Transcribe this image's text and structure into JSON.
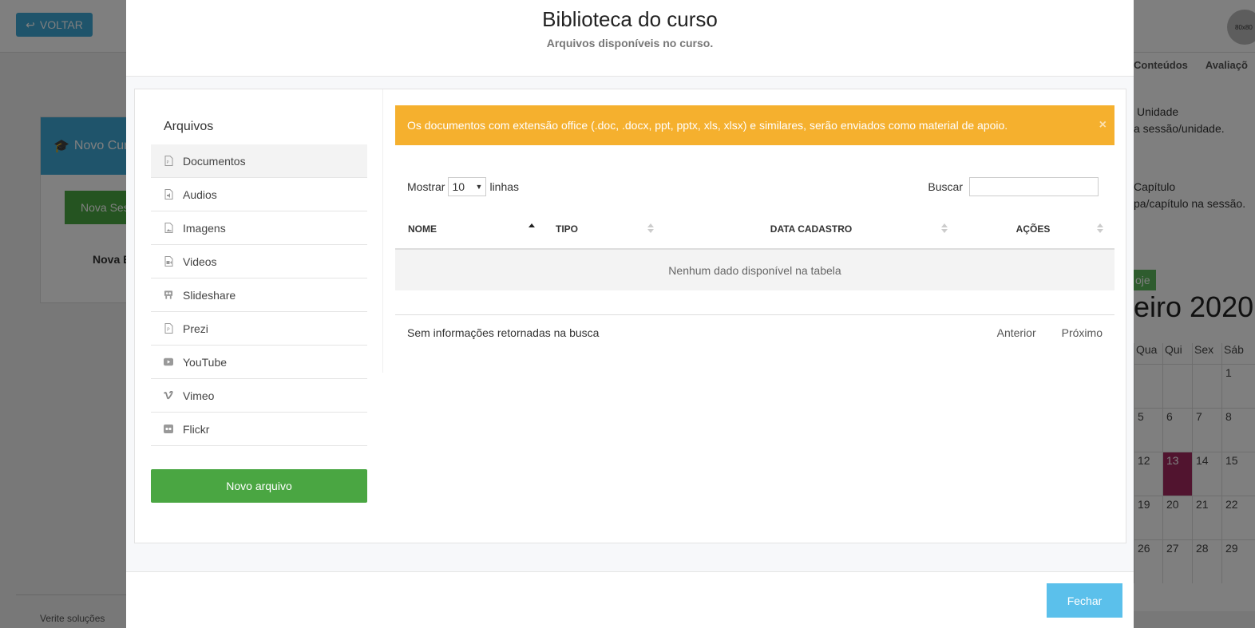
{
  "background": {
    "back_button": "VOLTAR",
    "avatar_text": "80x80",
    "card_title": "Novo Cur",
    "card_button": "Nova Ses",
    "card_text": "Nova E",
    "footer_text": "Verite soluções",
    "tabs": [
      "Conteúdos",
      "Avaliaçõ"
    ],
    "right_items": [
      {
        "title": "Unidade",
        "desc": "a sessão/unidade."
      },
      {
        "title": "Capítulo",
        "desc": "pa/capítulo na sessão."
      }
    ],
    "today_button": "oje",
    "month": "eiro 2020",
    "calendar_headers": [
      "Qua",
      "Qui",
      "Sex",
      "Sáb"
    ],
    "calendar_rows": [
      [
        "",
        "",
        "",
        "1"
      ],
      [
        "5",
        "6",
        "7",
        "8"
      ],
      [
        "12",
        "13",
        "14",
        "15"
      ],
      [
        "19",
        "20",
        "21",
        "22"
      ],
      [
        "26",
        "27",
        "28",
        "29"
      ]
    ],
    "today_day": "13"
  },
  "modal": {
    "title": "Biblioteca do curso",
    "subtitle": "Arquivos disponíveis no curso.",
    "sidebar": {
      "title": "Arquivos",
      "items": [
        {
          "label": "Documentos",
          "icon": "pdf-file-icon",
          "active": true
        },
        {
          "label": "Audios",
          "icon": "audio-file-icon",
          "active": false
        },
        {
          "label": "Imagens",
          "icon": "image-file-icon",
          "active": false
        },
        {
          "label": "Videos",
          "icon": "video-file-icon",
          "active": false
        },
        {
          "label": "Slideshare",
          "icon": "slideshare-icon",
          "active": false
        },
        {
          "label": "Prezi",
          "icon": "prezi-icon",
          "active": false
        },
        {
          "label": "YouTube",
          "icon": "youtube-icon",
          "active": false
        },
        {
          "label": "Vimeo",
          "icon": "vimeo-icon",
          "active": false
        },
        {
          "label": "Flickr",
          "icon": "flickr-icon",
          "active": false
        }
      ],
      "new_button": "Novo arquivo"
    },
    "alert": {
      "text": "Os documentos com extensão office (.doc, .docx, ppt, pptx, xls, xlsx) e similares, serão enviados como material de apoio.",
      "close": "×"
    },
    "controls": {
      "show_label": "Mostrar",
      "rows_value": "10",
      "rows_suffix": "linhas",
      "search_label": "Buscar",
      "search_value": ""
    },
    "table": {
      "columns": [
        "NOME",
        "TIPO",
        "DATA CADASTRO",
        "AÇÕES"
      ],
      "empty_text": "Nenhum dado disponível na tabela"
    },
    "info": "Sem informações retornadas na busca",
    "pager": {
      "prev": "Anterior",
      "next": "Próximo"
    },
    "close_button": "Fechar"
  },
  "colors": {
    "alert": "#f5b02e",
    "primary_green": "#4aa642",
    "close_blue": "#5bc0eb",
    "today": "#a2285f"
  }
}
